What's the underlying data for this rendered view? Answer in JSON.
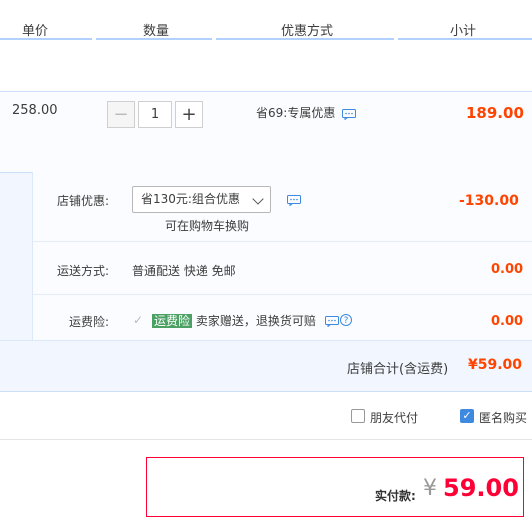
{
  "header": {
    "price_label": "单价",
    "quantity_label": "数量",
    "discount_label": "优惠方式",
    "subtotal_label": "小计"
  },
  "item": {
    "price": "258.00",
    "quantity": "1",
    "discount": "省69:专属优惠",
    "subtotal": "189.00"
  },
  "store": {
    "coupon_label": "店铺优惠:",
    "coupon_select": "省130元:组合优惠",
    "coupon_hint": "可在购物车换购",
    "coupon_amount": "-130.00",
    "shipping_label": "运送方式:",
    "shipping_value": "普通配送 快递 免邮",
    "shipping_amount": "0.00",
    "insurance_label": "运费险:",
    "insurance_badge": "运费险",
    "insurance_text": "卖家赠送，退换货可赔",
    "insurance_amount": "0.00",
    "total_label": "店铺合计(含运费)",
    "total_value": "¥59.00"
  },
  "options": {
    "friend_pay": "朋友代付",
    "friend_pay_checked": false,
    "anonymous": "匿名购买",
    "anonymous_checked": true
  },
  "payment": {
    "label": "实付款:",
    "currency": "¥",
    "amount": "59.00"
  },
  "colors": {
    "accent_red": "#ff0036",
    "blue": "#3d8ae0",
    "green_badge": "#4aa163"
  }
}
